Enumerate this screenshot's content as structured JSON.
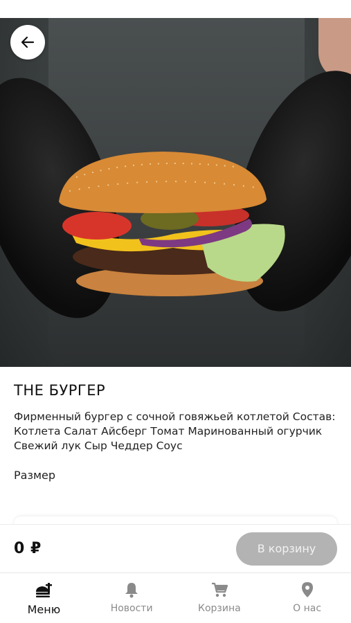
{
  "product": {
    "title": "THE БУРГЕР",
    "description": "Фирменный бургер с сочной говяжьей котлетой Состав: Котлета Салат Айсберг Томат Маринованный огурчик Свежий лук Сыр Чеддер Соус",
    "size_label": "Размер"
  },
  "checkout": {
    "price": "0 ₽",
    "cart_button_label": "В корзину"
  },
  "nav": {
    "items": [
      {
        "label": "Меню",
        "icon": "menu-food-icon",
        "active": true
      },
      {
        "label": "Новости",
        "icon": "bell-icon",
        "active": false
      },
      {
        "label": "Корзина",
        "icon": "cart-icon",
        "active": false
      },
      {
        "label": "О нас",
        "icon": "location-pin-icon",
        "active": false
      }
    ]
  },
  "colors": {
    "active_nav": "#111111",
    "inactive_nav": "#8a8a8a",
    "cart_button_disabled": "#b3b3b3"
  }
}
